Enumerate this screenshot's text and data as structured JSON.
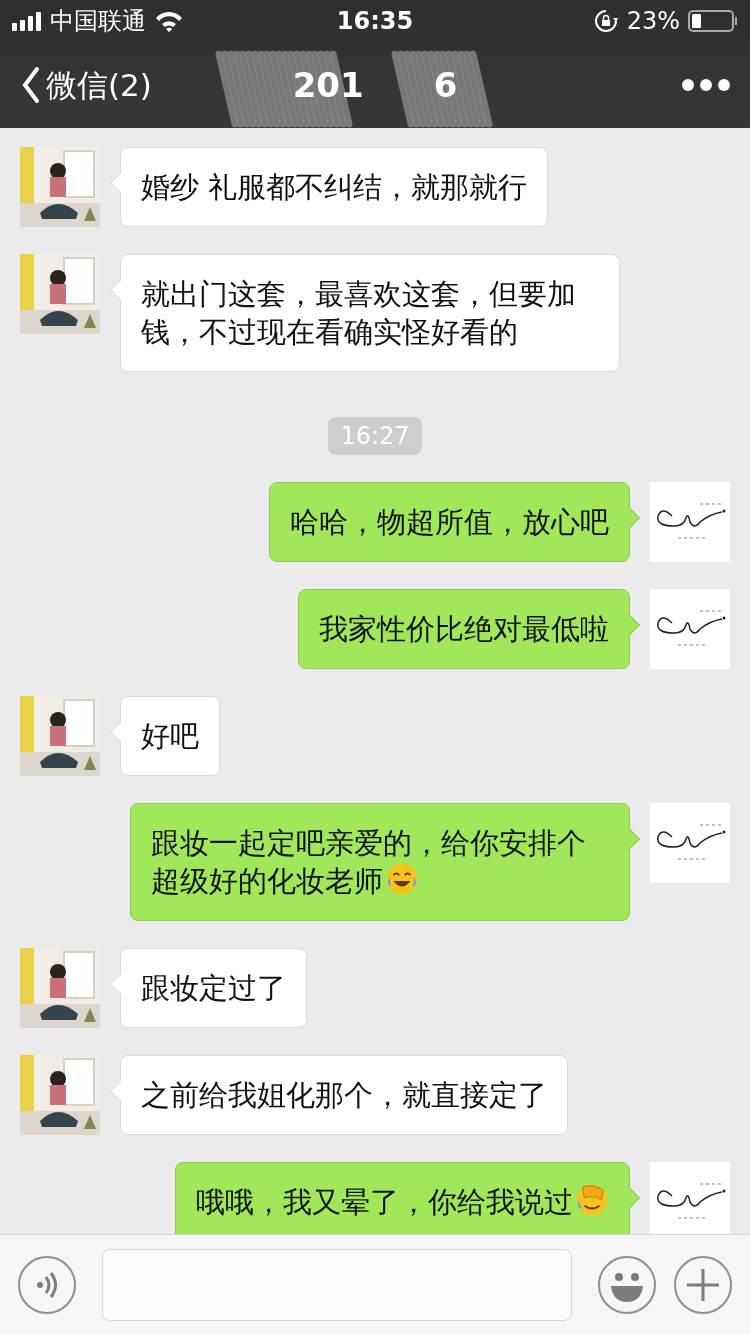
{
  "status_bar": {
    "carrier": "中国联通",
    "time": "16:35",
    "battery": "23%"
  },
  "nav": {
    "back": "微信(2)",
    "title_parts": [
      "201",
      "6"
    ]
  },
  "messages": [
    {
      "kind": "incoming",
      "content": [
        {
          "kind": "text",
          "text": "婚纱 礼服都不纠结，就那就行"
        }
      ]
    },
    {
      "kind": "incoming",
      "content": [
        {
          "kind": "text",
          "text": "就出门这套，最喜欢这套，但要加钱，不过现在看确实怪好看的"
        }
      ]
    },
    {
      "kind": "time",
      "text": "16:27"
    },
    {
      "kind": "outgoing",
      "content": [
        {
          "kind": "text",
          "text": "哈哈，物超所值，放心吧"
        }
      ]
    },
    {
      "kind": "outgoing",
      "content": [
        {
          "kind": "text",
          "text": "我家性价比绝对最低啦"
        }
      ]
    },
    {
      "kind": "incoming",
      "content": [
        {
          "kind": "text",
          "text": "好吧"
        }
      ]
    },
    {
      "kind": "outgoing",
      "content": [
        {
          "kind": "text",
          "text": "跟妆一起定吧亲爱的，给你安排个超级好的化妆老师"
        },
        {
          "kind": "laughing"
        }
      ]
    },
    {
      "kind": "incoming",
      "content": [
        {
          "kind": "text",
          "text": "跟妆定过了"
        }
      ]
    },
    {
      "kind": "incoming",
      "content": [
        {
          "kind": "text",
          "text": "之前给我姐化那个，就直接定了"
        }
      ]
    },
    {
      "kind": "outgoing",
      "content": [
        {
          "kind": "text",
          "text": "哦哦，我又晕了，你给我说过"
        },
        {
          "kind": "facepalm"
        }
      ]
    }
  ]
}
